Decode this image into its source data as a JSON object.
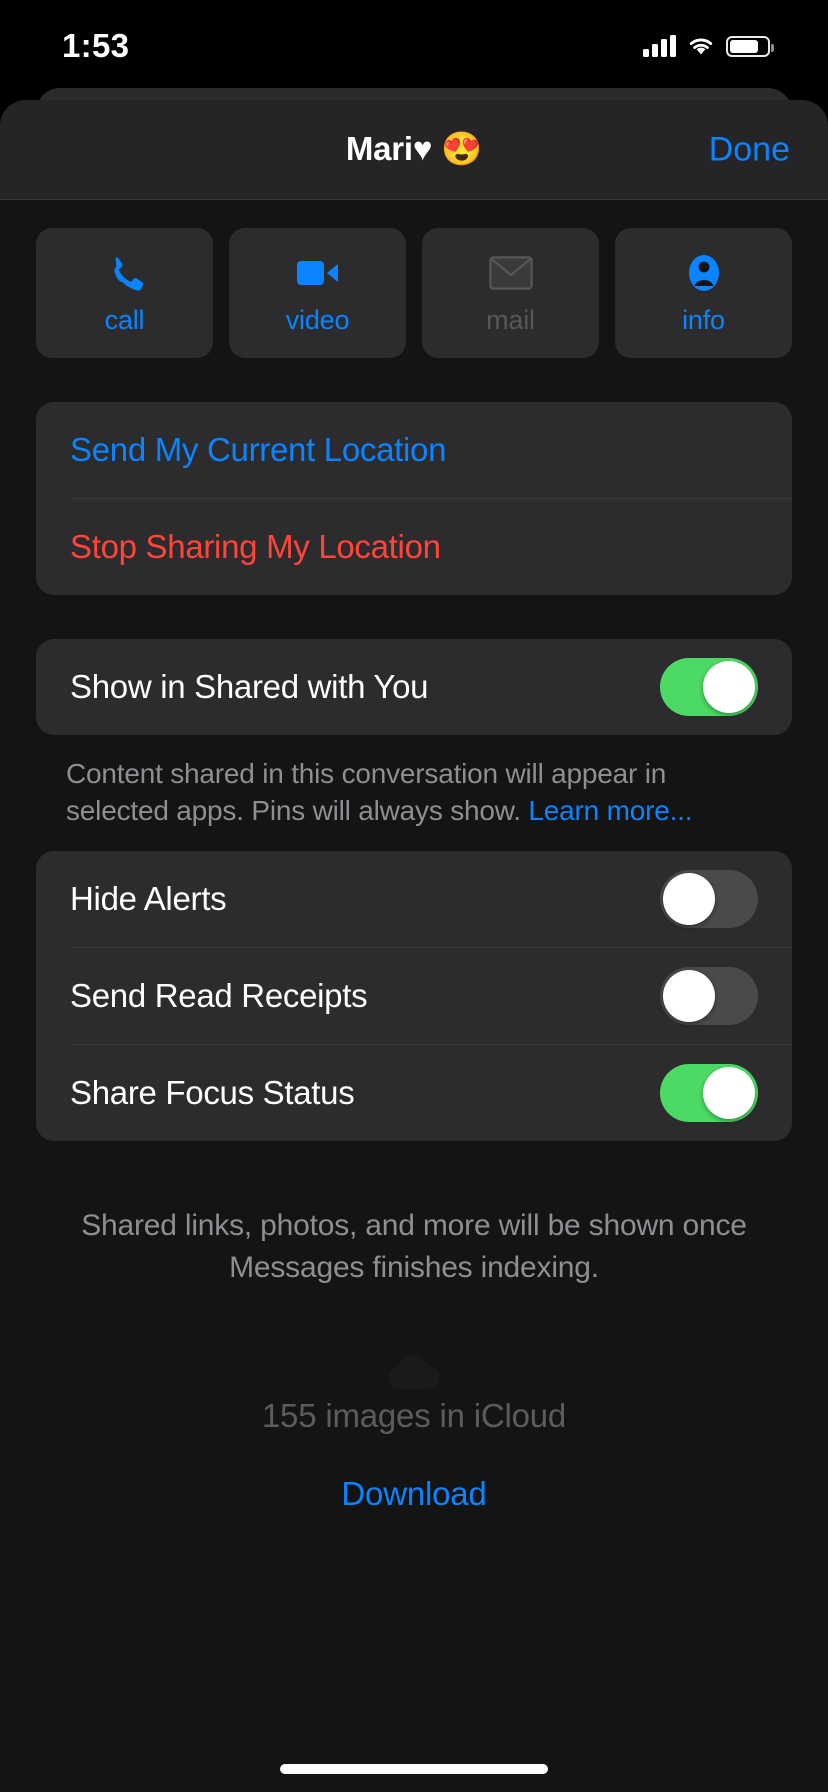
{
  "status_bar": {
    "time": "1:53",
    "cellular_icon": "cellular-bars-icon",
    "wifi_icon": "wifi-icon",
    "battery_icon": "battery-icon"
  },
  "nav": {
    "title": "Mari♥ 😍",
    "done_label": "Done"
  },
  "quick_actions": [
    {
      "id": "call",
      "label": "call",
      "icon": "phone-icon",
      "enabled": true
    },
    {
      "id": "video",
      "label": "video",
      "icon": "video-camera-icon",
      "enabled": true
    },
    {
      "id": "mail",
      "label": "mail",
      "icon": "envelope-icon",
      "enabled": false
    },
    {
      "id": "info",
      "label": "info",
      "icon": "person-circle-icon",
      "enabled": true
    }
  ],
  "location_section": {
    "send_location_label": "Send My Current Location",
    "stop_sharing_label": "Stop Sharing My Location"
  },
  "shared_with_you": {
    "label": "Show in Shared with You",
    "toggle_on": true,
    "footnote_text": "Content shared in this conversation will appear in selected apps. Pins will always show. ",
    "footnote_link": "Learn more..."
  },
  "settings_section": [
    {
      "label": "Hide Alerts",
      "toggle_on": false
    },
    {
      "label": "Send Read Receipts",
      "toggle_on": false
    },
    {
      "label": "Share Focus Status",
      "toggle_on": true
    }
  ],
  "indexing_note": "Shared links, photos, and more will be shown once Messages finishes indexing.",
  "icloud": {
    "icon": "cloud-icon",
    "count_text": "155 images in iCloud",
    "download_label": "Download"
  },
  "colors": {
    "accent_blue": "#0a84ff",
    "destructive_red": "#ff453a",
    "toggle_green": "#4cd964",
    "secondary_text": "#8e8e93",
    "card_background": "#2c2c2e",
    "sheet_background": "#141415"
  }
}
